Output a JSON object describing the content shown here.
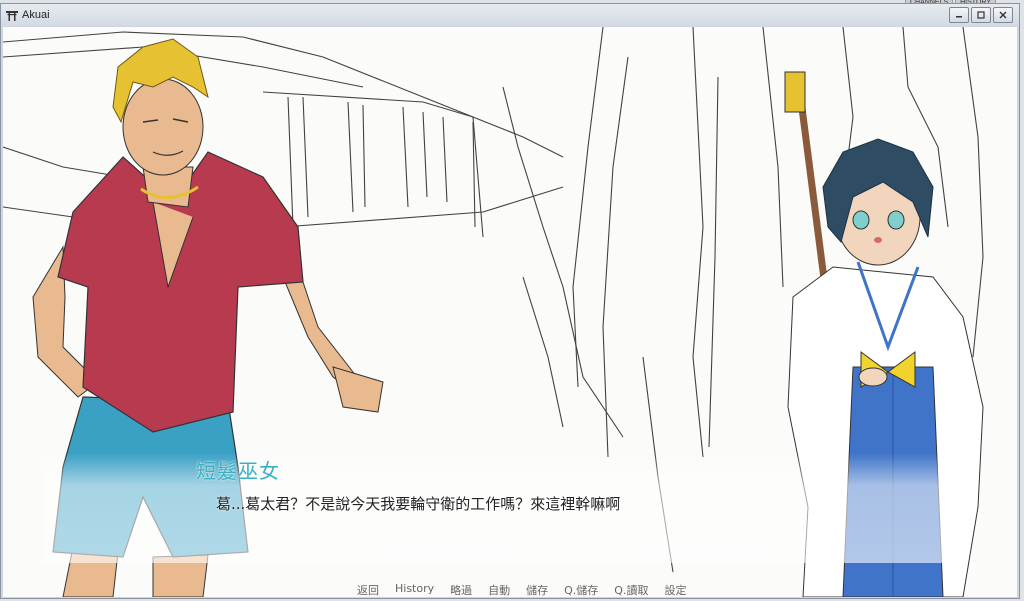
{
  "background_tabs": [
    "CHANNELS",
    "HISTORY"
  ],
  "window": {
    "title": "Akuai",
    "icon": "torii-icon",
    "controls": [
      "minimize",
      "maximize",
      "close"
    ]
  },
  "dialogue": {
    "speaker": "短髮巫女",
    "text": "葛...葛太君？不是說今天我要輪守衛的工作嗎？來這裡幹嘛啊"
  },
  "quick_menu": [
    "返回",
    "History",
    "略過",
    "自動",
    "儲存",
    "Q.儲存",
    "Q.讀取",
    "設定"
  ],
  "colors": {
    "speaker": "#3ab0c2",
    "shirt": "#b83a4e",
    "shorts": "#3aa0c4",
    "hair_blond": "#e6c232",
    "hair_miko": "#2e4c63",
    "hakama": "#3f74c8",
    "bow": "#f2d22c",
    "skin": "#e9b98f"
  }
}
